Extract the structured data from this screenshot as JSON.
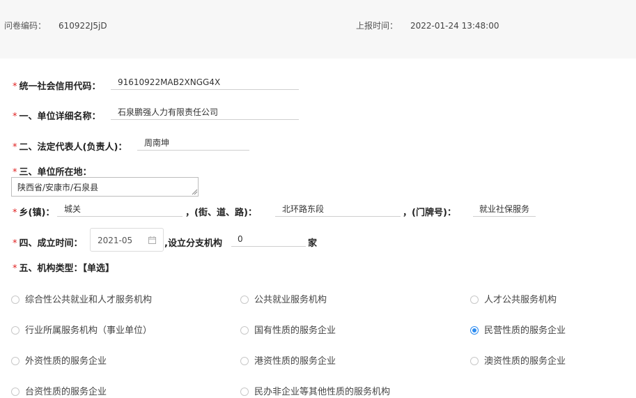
{
  "header": {
    "survey_code_label": "问卷编码：",
    "survey_code": "610922J5jD",
    "report_time_label": "上报时间：",
    "report_time": "2022-01-24 13:48:00"
  },
  "form": {
    "required_mark": "*",
    "credit_code": {
      "label": "统一社会信用代码：",
      "value": "91610922MAB2XNGG4X"
    },
    "unit_name": {
      "label": "一、单位详细名称：",
      "value": "石泉鹏强人力有限责任公司"
    },
    "legal_rep": {
      "label": "二、法定代表人(负责人)：",
      "value": "周南坤"
    },
    "location": {
      "label": "三、单位所在地：",
      "value": "陕西省/安康市/石泉县"
    },
    "town": {
      "label": "乡(镇)：",
      "value": "城关"
    },
    "street": {
      "label": "，(街、道、路)：",
      "value": "北环路东段"
    },
    "door_no": {
      "label": "，(门牌号)：",
      "value": "就业社保服务"
    },
    "founded": {
      "label": "四、成立时间：",
      "value": "2021-05",
      "branch_label": ",设立分支机构",
      "branch_count": "0",
      "branch_unit": "家"
    },
    "org_type": {
      "label": "五、机构类型：【单选】",
      "selected": "民营性质的服务企业",
      "options": [
        "综合性公共就业和人才服务机构",
        "公共就业服务机构",
        "人才公共服务机构",
        "行业所属服务机构（事业单位）",
        "国有性质的服务企业",
        "民营性质的服务企业",
        "外资性质的服务企业",
        "港资性质的服务企业",
        "澳资性质的服务企业",
        "台资性质的服务企业",
        "民办非企业等其他性质的服务机构"
      ]
    }
  }
}
